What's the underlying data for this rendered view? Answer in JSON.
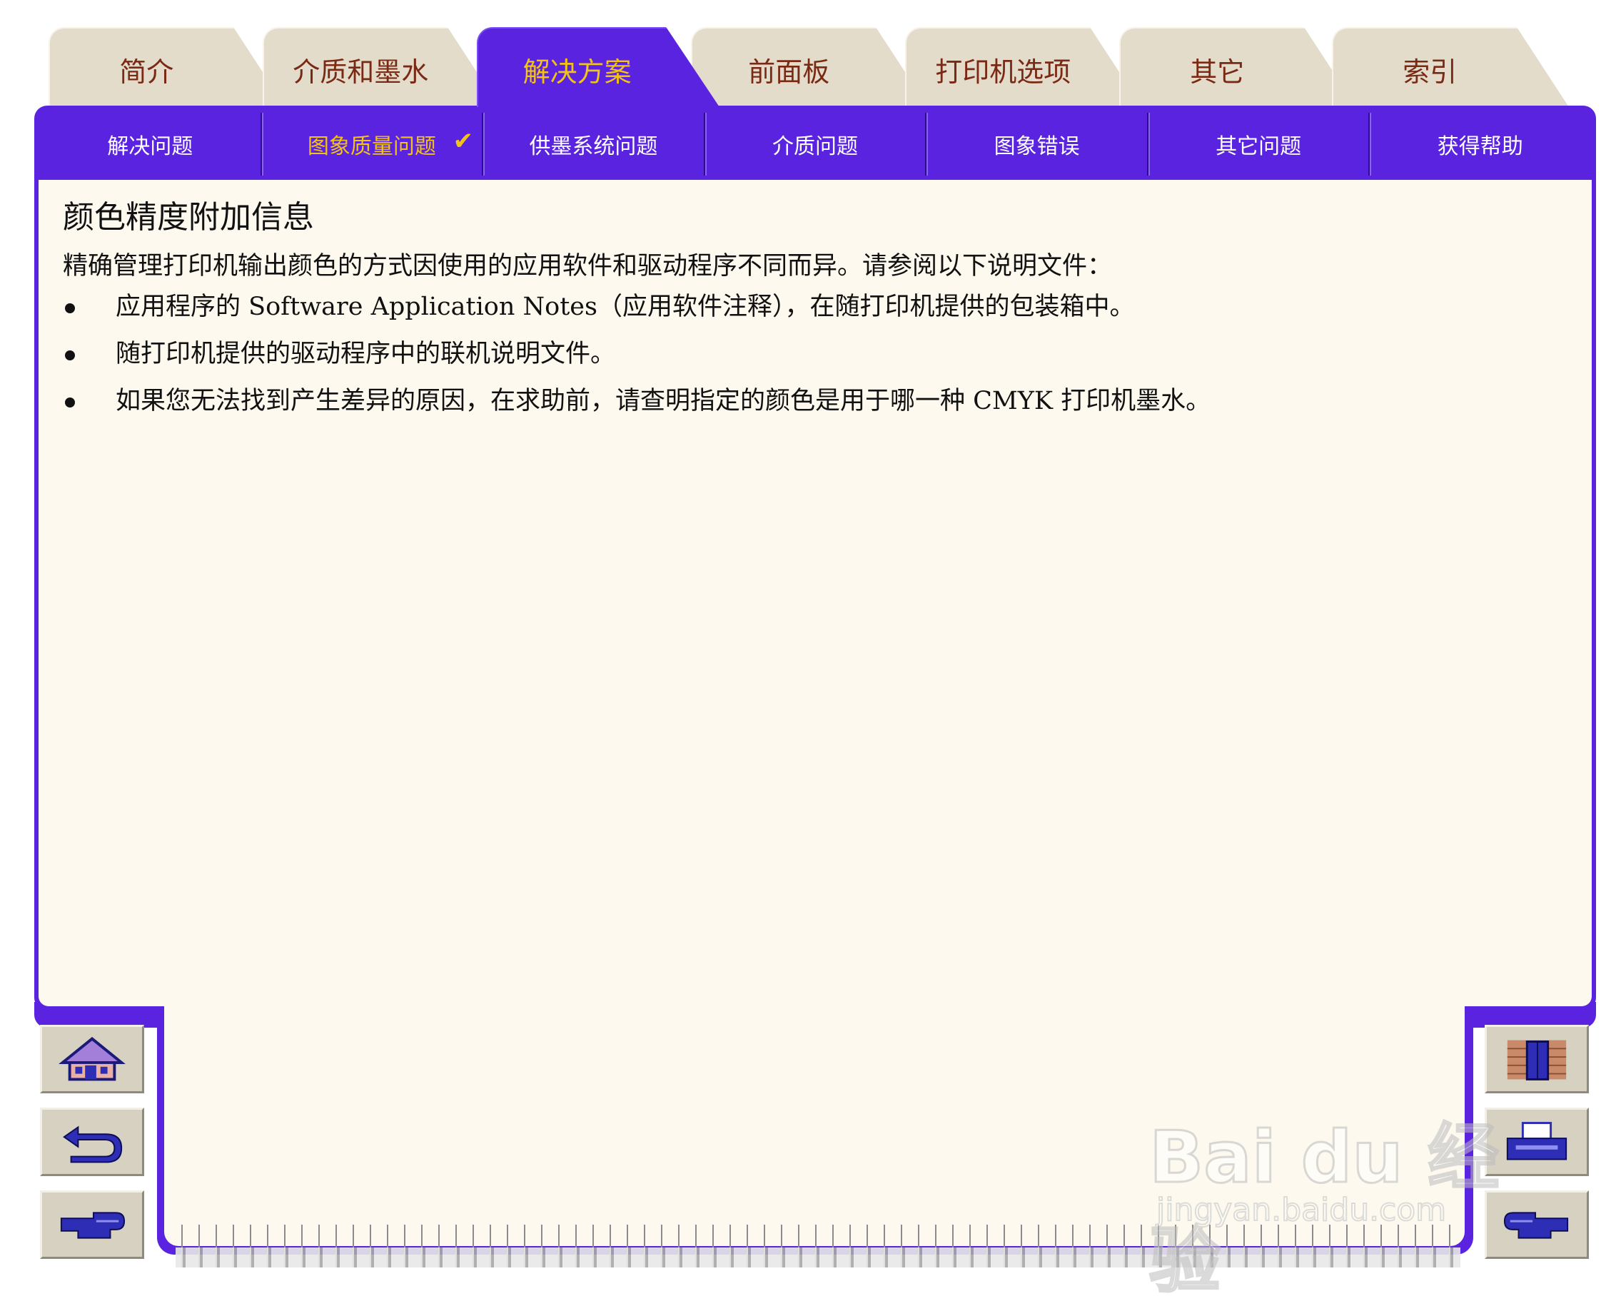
{
  "tabs": [
    {
      "label": "简介"
    },
    {
      "label": "介质和墨水"
    },
    {
      "label": "解决方案",
      "active": true
    },
    {
      "label": "前面板"
    },
    {
      "label": "打印机选项"
    },
    {
      "label": "其它"
    },
    {
      "label": "索引"
    }
  ],
  "subnav": [
    {
      "label": "解决问题"
    },
    {
      "label": "图象质量问题",
      "active": true
    },
    {
      "label": "供墨系统问题"
    },
    {
      "label": "介质问题"
    },
    {
      "label": "图象错误"
    },
    {
      "label": "其它问题"
    },
    {
      "label": "获得帮助"
    }
  ],
  "active_marker": "✔",
  "page": {
    "title": "颜色精度附加信息",
    "intro": "精确管理打印机输出颜色的方式因使用的应用软件和驱动程序不同而异。请参阅以下说明文件：",
    "bullets": [
      "应用程序的 Software Application Notes（应用软件注释），在随打印机提供的包装箱中。",
      "随打印机提供的驱动程序中的联机说明文件。",
      "如果您无法找到产生差异的原因，在求助前，请查明指定的颜色是用于哪一种 CMYK 打印机墨水。"
    ]
  },
  "nav_buttons": {
    "left": [
      "home-icon",
      "back-icon",
      "next-page-icon"
    ],
    "right": [
      "exit-door-icon",
      "printer-icon",
      "previous-page-icon"
    ]
  },
  "watermark": {
    "logo": "Bai du 经验",
    "url": "jingyan.baidu.com"
  },
  "colors": {
    "frame_purple": "#5a23e0",
    "tab_beige": "#e3dccb",
    "active_text": "#f2c316",
    "tab_text": "#7a2a14",
    "content_bg": "#fdf9ee"
  }
}
